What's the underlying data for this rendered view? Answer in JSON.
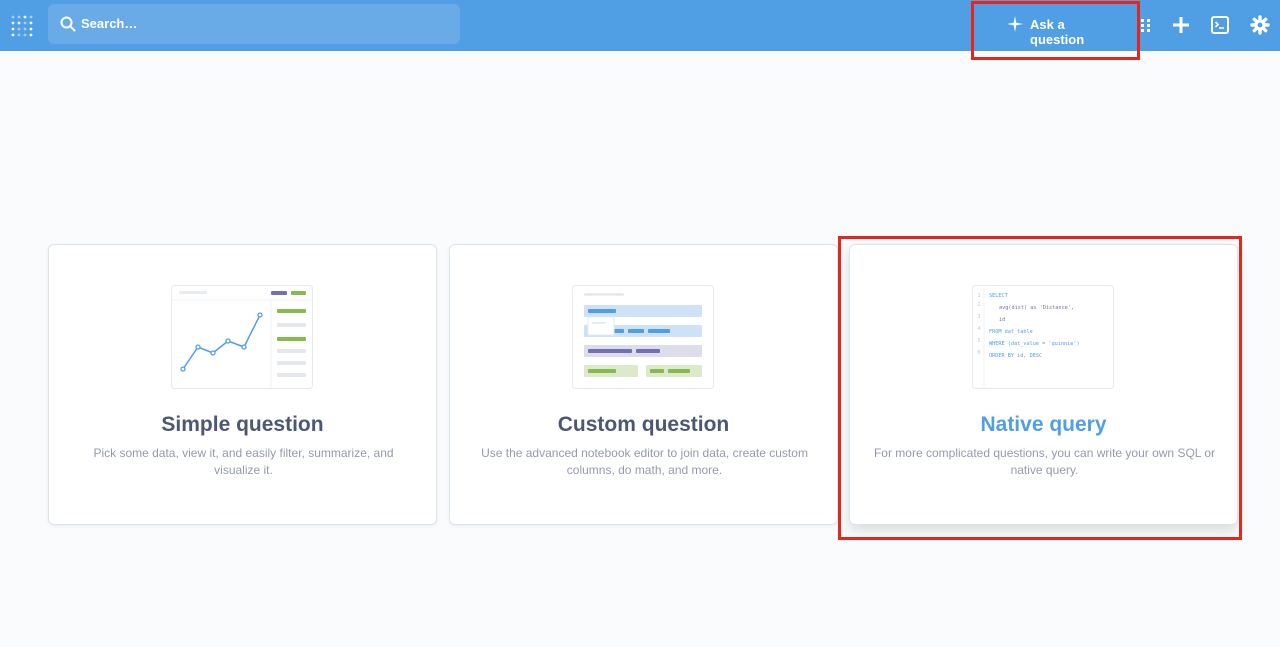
{
  "header": {
    "search_placeholder": "Search…",
    "ask_label": "Ask a question"
  },
  "cards": [
    {
      "title": "Simple question",
      "description": "Pick some data, view it, and easily filter, summarize, and visualize it."
    },
    {
      "title": "Custom question",
      "description": "Use the advanced notebook editor to join data, create custom columns, do math, and more."
    },
    {
      "title": "Native query",
      "description": "For more complicated questions, you can write your own SQL or native query."
    }
  ],
  "sql_preview": {
    "line_numbers": [
      "1",
      "2",
      "3",
      "4",
      "5",
      "6"
    ],
    "lines": [
      "SELECT",
      "avg(dist) as 'Distance',",
      "id",
      "FROM dat_table",
      "WHERE (dat_value = 'quinnie')",
      "ORDER BY id, DESC"
    ]
  },
  "colors": {
    "accent": "#509ee3",
    "highlight": "#e5261d",
    "green": "#84bb4c",
    "purple": "#7172ad"
  }
}
